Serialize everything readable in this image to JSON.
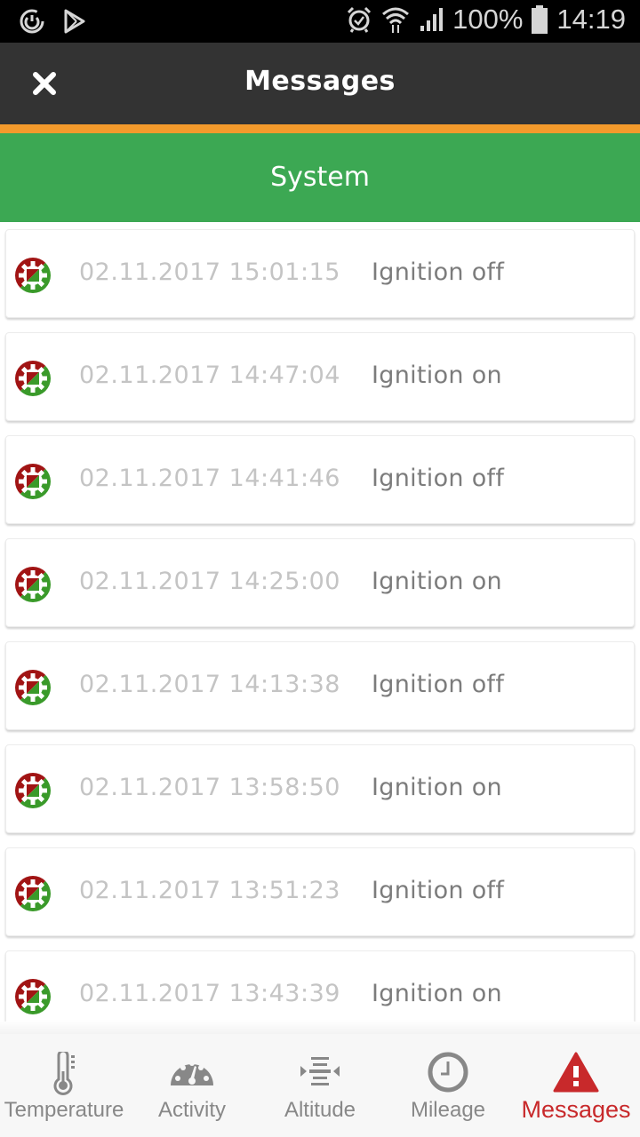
{
  "status_bar": {
    "left_icons": [
      "sync-icon",
      "play-store-icon"
    ],
    "right_icons": [
      "alarm-icon",
      "wifi-icon",
      "signal-icon"
    ],
    "battery": "100%",
    "time": "14:19"
  },
  "header": {
    "close_icon": "close-icon",
    "title": "Messages"
  },
  "colors": {
    "appbar": "#333333",
    "accent": "#f39a2c",
    "section": "#3ca853",
    "active_tab": "#c8292b",
    "inactive_tab": "#888888"
  },
  "section": {
    "title": "System"
  },
  "messages": [
    {
      "icon": "system-gear-icon",
      "timestamp": "02.11.2017 15:01:15",
      "text": "Ignition off"
    },
    {
      "icon": "system-gear-icon",
      "timestamp": "02.11.2017 14:47:04",
      "text": "Ignition on"
    },
    {
      "icon": "system-gear-icon",
      "timestamp": "02.11.2017 14:41:46",
      "text": "Ignition off"
    },
    {
      "icon": "system-gear-icon",
      "timestamp": "02.11.2017 14:25:00",
      "text": "Ignition on"
    },
    {
      "icon": "system-gear-icon",
      "timestamp": "02.11.2017 14:13:38",
      "text": "Ignition off"
    },
    {
      "icon": "system-gear-icon",
      "timestamp": "02.11.2017 13:58:50",
      "text": "Ignition on"
    },
    {
      "icon": "system-gear-icon",
      "timestamp": "02.11.2017 13:51:23",
      "text": "Ignition off"
    },
    {
      "icon": "system-gear-icon",
      "timestamp": "02.11.2017 13:43:39",
      "text": "Ignition on"
    }
  ],
  "bottom_nav": {
    "active": "Messages",
    "tabs": [
      {
        "label": "Temperature",
        "icon": "thermometer-icon"
      },
      {
        "label": "Activity",
        "icon": "speedometer-icon"
      },
      {
        "label": "Altitude",
        "icon": "altitude-icon"
      },
      {
        "label": "Mileage",
        "icon": "clock-icon"
      },
      {
        "label": "Messages",
        "icon": "warning-icon"
      }
    ]
  }
}
